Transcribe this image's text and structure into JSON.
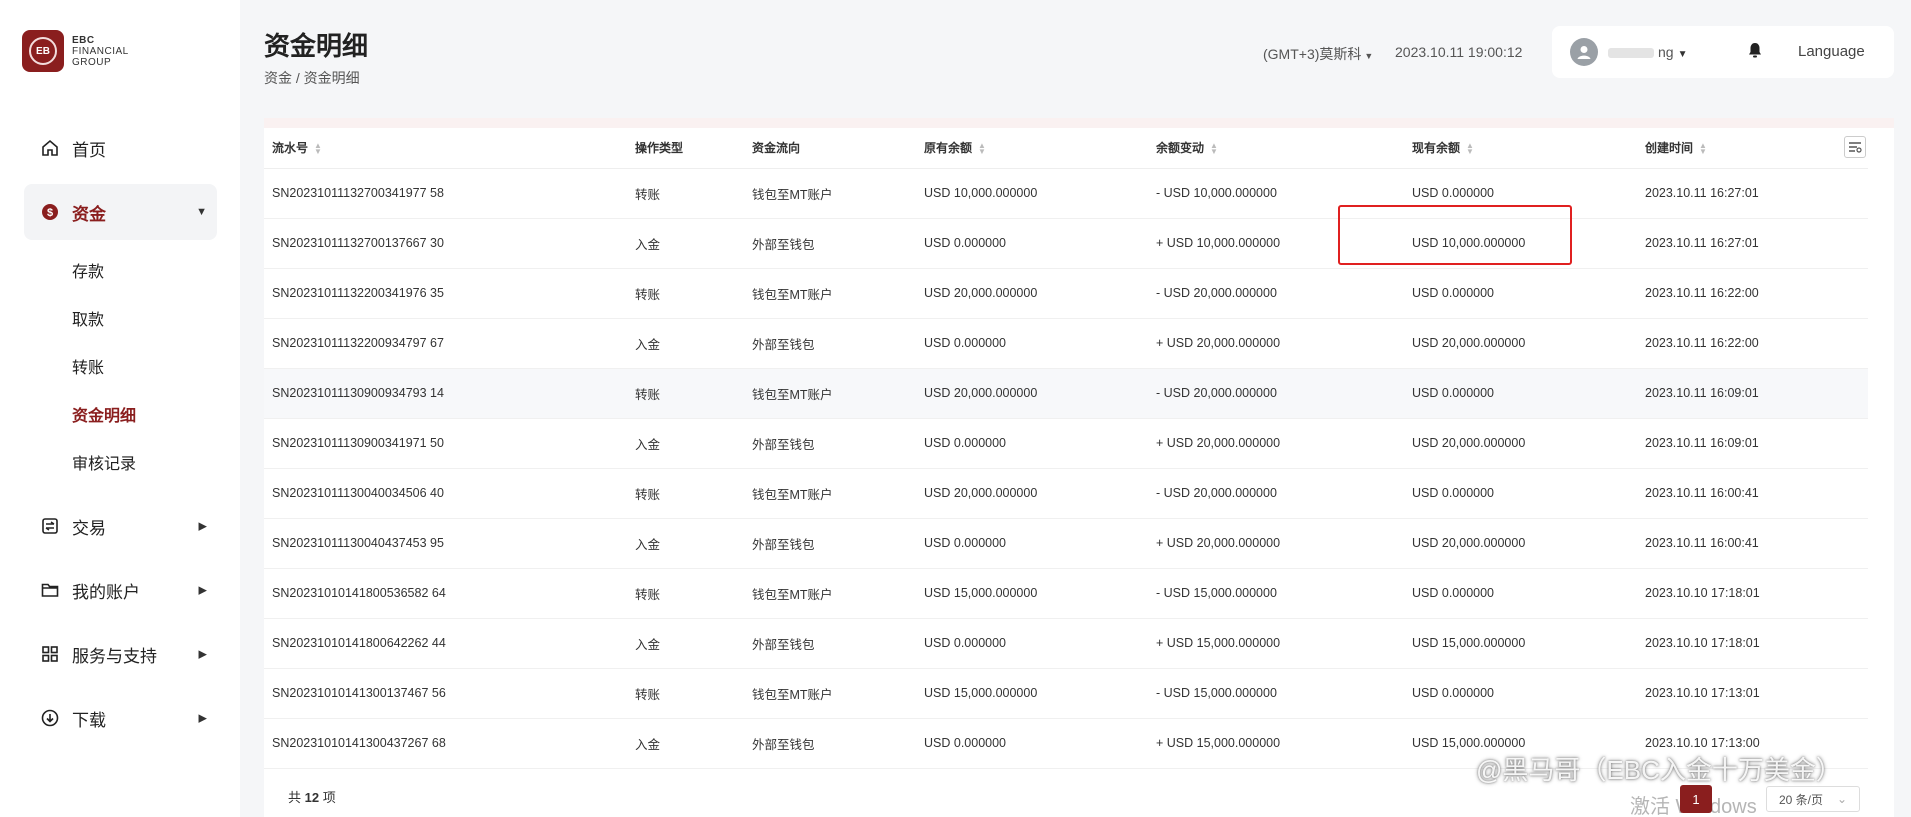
{
  "app": {
    "logo": {
      "line1": "EBC",
      "line2": "FINANCIAL",
      "line3": "GROUP"
    }
  },
  "sidebar": {
    "items": [
      {
        "label": "首页",
        "icon": "home-icon"
      },
      {
        "label": "资金",
        "icon": "dollar-circle-icon",
        "active": true,
        "children": [
          {
            "label": "存款"
          },
          {
            "label": "取款"
          },
          {
            "label": "转账"
          },
          {
            "label": "资金明细",
            "current": true
          },
          {
            "label": "审核记录"
          }
        ]
      },
      {
        "label": "交易",
        "icon": "trade-icon"
      },
      {
        "label": "我的账户",
        "icon": "folder-icon"
      },
      {
        "label": "服务与支持",
        "icon": "grid-icon"
      },
      {
        "label": "下载",
        "icon": "download-icon"
      }
    ]
  },
  "header": {
    "title": "资金明细",
    "breadcrumb": "资金 / 资金明细",
    "timezone": "(GMT+3)莫斯科",
    "datetime": "2023.10.11 19:00:12",
    "username_suffix": "ng",
    "language": "Language"
  },
  "table": {
    "columns": [
      "流水号",
      "操作类型",
      "资金流向",
      "原有余额",
      "余额变动",
      "现有余额",
      "创建时间"
    ],
    "rows": [
      [
        "SN20231011132700341977 58",
        "转账",
        "钱包至MT账户",
        "USD 10,000.000000",
        "- USD 10,000.000000",
        "USD 0.000000",
        "2023.10.11 16:27:01"
      ],
      [
        "SN20231011132700137667 30",
        "入金",
        "外部至钱包",
        "USD 0.000000",
        "+ USD 10,000.000000",
        "USD 10,000.000000",
        "2023.10.11 16:27:01"
      ],
      [
        "SN20231011132200341976 35",
        "转账",
        "钱包至MT账户",
        "USD 20,000.000000",
        "- USD 20,000.000000",
        "USD 0.000000",
        "2023.10.11 16:22:00"
      ],
      [
        "SN20231011132200934797 67",
        "入金",
        "外部至钱包",
        "USD 0.000000",
        "+ USD 20,000.000000",
        "USD 20,000.000000",
        "2023.10.11 16:22:00"
      ],
      [
        "SN20231011130900934793 14",
        "转账",
        "钱包至MT账户",
        "USD 20,000.000000",
        "- USD 20,000.000000",
        "USD 0.000000",
        "2023.10.11 16:09:01"
      ],
      [
        "SN20231011130900341971 50",
        "入金",
        "外部至钱包",
        "USD 0.000000",
        "+ USD 20,000.000000",
        "USD 20,000.000000",
        "2023.10.11 16:09:01"
      ],
      [
        "SN20231011130040034506 40",
        "转账",
        "钱包至MT账户",
        "USD 20,000.000000",
        "- USD 20,000.000000",
        "USD 0.000000",
        "2023.10.11 16:00:41"
      ],
      [
        "SN20231011130040437453 95",
        "入金",
        "外部至钱包",
        "USD 0.000000",
        "+ USD 20,000.000000",
        "USD 20,000.000000",
        "2023.10.11 16:00:41"
      ],
      [
        "SN20231010141800536582 64",
        "转账",
        "钱包至MT账户",
        "USD 15,000.000000",
        "- USD 15,000.000000",
        "USD 0.000000",
        "2023.10.10 17:18:01"
      ],
      [
        "SN20231010141800642262 44",
        "入金",
        "外部至钱包",
        "USD 0.000000",
        "+ USD 15,000.000000",
        "USD 15,000.000000",
        "2023.10.10 17:18:01"
      ],
      [
        "SN20231010141300137467 56",
        "转账",
        "钱包至MT账户",
        "USD 15,000.000000",
        "- USD 15,000.000000",
        "USD 0.000000",
        "2023.10.10 17:13:01"
      ],
      [
        "SN20231010141300437267 68",
        "入金",
        "外部至钱包",
        "USD 0.000000",
        "+ USD 15,000.000000",
        "USD 15,000.000000",
        "2023.10.10 17:13:00"
      ]
    ]
  },
  "footer": {
    "total_prefix": "共",
    "total_count": "12",
    "total_suffix": "项",
    "current_page": "1",
    "page_size": "20 条/页"
  },
  "overlays": {
    "credit": "@黑马哥（EBC入金十万美金）",
    "activate": "激活 Windows"
  },
  "colors": {
    "brand": "#8a1e1e",
    "highlight_box": "#e02020"
  }
}
